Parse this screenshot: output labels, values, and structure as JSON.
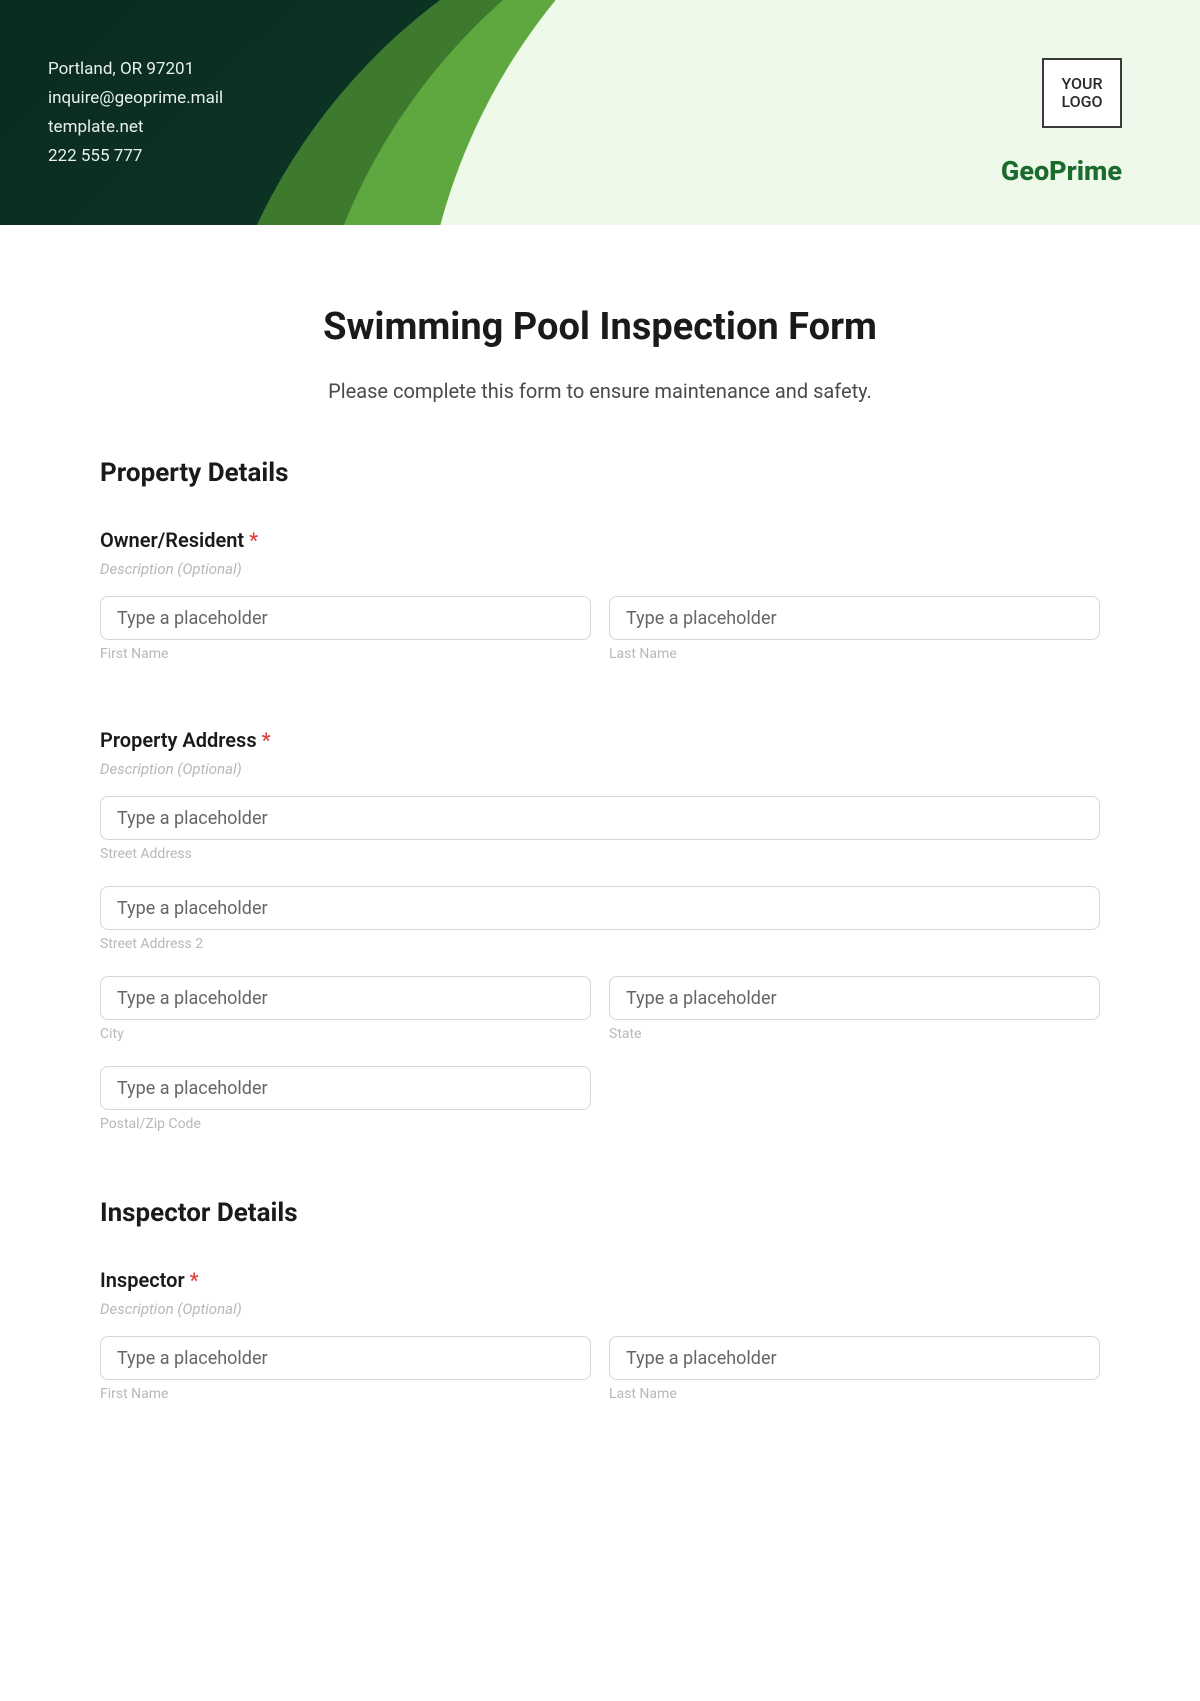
{
  "header": {
    "address": "Portland, OR 97201",
    "email": "inquire@geoprime.mail",
    "website": "template.net",
    "phone": "222 555 777",
    "logo_text": "YOUR LOGO",
    "brand": "GeoPrime"
  },
  "form": {
    "title": "Swimming Pool Inspection Form",
    "subtitle": "Please complete this form to ensure maintenance and safety."
  },
  "section_property": {
    "heading": "Property Details",
    "owner": {
      "label": "Owner/Resident",
      "desc": "Description (Optional)",
      "first_placeholder": "Type a placeholder",
      "first_sub": "First Name",
      "last_placeholder": "Type a placeholder",
      "last_sub": "Last Name"
    },
    "address": {
      "label": "Property Address",
      "desc": "Description (Optional)",
      "street_ph": "Type a placeholder",
      "street_sub": "Street Address",
      "street2_ph": "Type a placeholder",
      "street2_sub": "Street Address 2",
      "city_ph": "Type a placeholder",
      "city_sub": "City",
      "state_ph": "Type a placeholder",
      "state_sub": "State",
      "zip_ph": "Type a placeholder",
      "zip_sub": "Postal/Zip Code"
    }
  },
  "section_inspector": {
    "heading": "Inspector Details",
    "inspector": {
      "label": "Inspector",
      "desc": "Description (Optional)",
      "first_placeholder": "Type a placeholder",
      "first_sub": "First Name",
      "last_placeholder": "Type a placeholder",
      "last_sub": "Last Name"
    }
  },
  "required_marker": "*"
}
